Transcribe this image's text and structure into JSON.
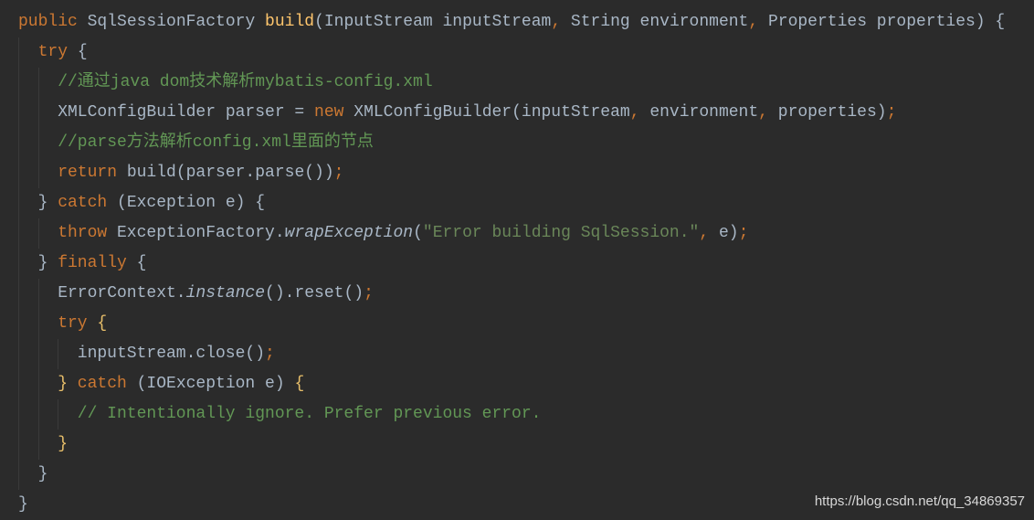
{
  "colors": {
    "background": "#2b2b2b",
    "keyword": "#cc7832",
    "text": "#a9b7c6",
    "method_decl": "#ffc66d",
    "comment": "#629755",
    "string": "#6a8759"
  },
  "code_lines": [
    {
      "indent": 0,
      "tokens": [
        [
          "public",
          "kw"
        ],
        [
          " SqlSessionFactory ",
          ""
        ],
        [
          "build",
          "fn"
        ],
        [
          "(InputStream inputStream",
          ""
        ],
        [
          ",",
          "kw"
        ],
        [
          " String environment",
          ""
        ],
        [
          ",",
          "kw"
        ],
        [
          " Properties properties) ",
          ""
        ],
        [
          "{",
          "br"
        ]
      ]
    },
    {
      "indent": 1,
      "tokens": [
        [
          "try ",
          "kw"
        ],
        [
          "{",
          "br"
        ]
      ]
    },
    {
      "indent": 2,
      "tokens": [
        [
          "//通过java dom技术解析mybatis-config.xml",
          "cm"
        ]
      ]
    },
    {
      "indent": 2,
      "tokens": [
        [
          "XMLConfigBuilder parser = ",
          ""
        ],
        [
          "new ",
          "kw"
        ],
        [
          "XMLConfigBuilder(inputStream",
          ""
        ],
        [
          ",",
          "kw"
        ],
        [
          " environment",
          ""
        ],
        [
          ",",
          "kw"
        ],
        [
          " properties)",
          ""
        ],
        [
          ";",
          "kw"
        ]
      ]
    },
    {
      "indent": 2,
      "tokens": [
        [
          "//parse方法解析config.xml里面的节点",
          "cm"
        ]
      ]
    },
    {
      "indent": 2,
      "tokens": [
        [
          "return ",
          "kw"
        ],
        [
          "build(parser.parse())",
          ""
        ],
        [
          ";",
          "kw"
        ]
      ]
    },
    {
      "indent": 1,
      "tokens": [
        [
          "} ",
          "br"
        ],
        [
          "catch ",
          "kw"
        ],
        [
          "(Exception e) ",
          ""
        ],
        [
          "{",
          "br"
        ]
      ]
    },
    {
      "indent": 2,
      "tokens": [
        [
          "throw ",
          "kw"
        ],
        [
          "ExceptionFactory.",
          ""
        ],
        [
          "wrapException",
          "it"
        ],
        [
          "(",
          ""
        ],
        [
          "\"Error building SqlSession.\"",
          "str"
        ],
        [
          ",",
          "kw"
        ],
        [
          " e)",
          ""
        ],
        [
          ";",
          "kw"
        ]
      ]
    },
    {
      "indent": 1,
      "tokens": [
        [
          "} ",
          "br"
        ],
        [
          "finally ",
          "kw"
        ],
        [
          "{",
          "br"
        ]
      ]
    },
    {
      "indent": 2,
      "tokens": [
        [
          "ErrorContext.",
          ""
        ],
        [
          "instance",
          "it"
        ],
        [
          "().reset()",
          ""
        ],
        [
          ";",
          "kw"
        ]
      ]
    },
    {
      "indent": 2,
      "tokens": [
        [
          "try ",
          "kw"
        ],
        [
          "{",
          "brh"
        ]
      ]
    },
    {
      "indent": 3,
      "tokens": [
        [
          "inputStream.close()",
          ""
        ],
        [
          ";",
          "kw"
        ]
      ]
    },
    {
      "indent": 2,
      "tokens": [
        [
          "} ",
          "brh"
        ],
        [
          "catch ",
          "kw"
        ],
        [
          "(IOException e) ",
          ""
        ],
        [
          "{",
          "brh"
        ]
      ]
    },
    {
      "indent": 3,
      "tokens": [
        [
          "// Intentionally ignore. Prefer previous error.",
          "cm"
        ]
      ]
    },
    {
      "indent": 2,
      "tokens": [
        [
          "}",
          "brh"
        ]
      ]
    },
    {
      "indent": 1,
      "tokens": [
        [
          "}",
          "br"
        ]
      ]
    },
    {
      "indent": 0,
      "tokens": [
        [
          "}",
          "br"
        ]
      ]
    }
  ],
  "watermark": "https://blog.csdn.net/qq_34869357"
}
